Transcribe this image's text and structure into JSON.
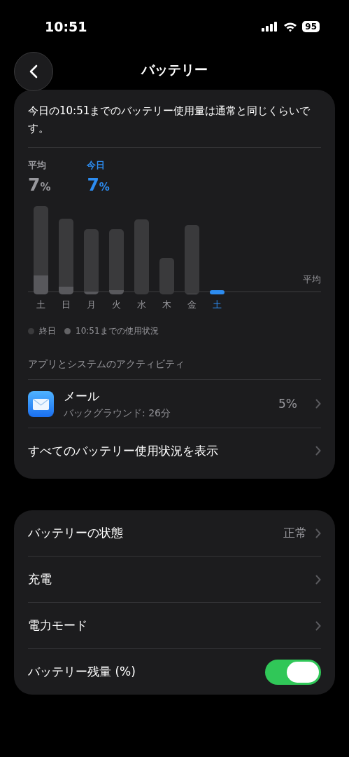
{
  "status_bar": {
    "time": "10:51",
    "battery": "95"
  },
  "nav": {
    "title": "バッテリー"
  },
  "summary": "今日の10:51までのバッテリー使用量は通常と同じくらいです。",
  "stats": [
    {
      "label": "平均",
      "value": "7",
      "unit": "%",
      "selected": false
    },
    {
      "label": "今日",
      "value": "7",
      "unit": "%",
      "selected": true
    }
  ],
  "chart": {
    "average_label": "平均",
    "days": [
      {
        "label": "土",
        "selected": false
      },
      {
        "label": "日",
        "selected": false
      },
      {
        "label": "月",
        "selected": false
      },
      {
        "label": "火",
        "selected": false
      },
      {
        "label": "水",
        "selected": false
      },
      {
        "label": "木",
        "selected": false
      },
      {
        "label": "金",
        "selected": false
      },
      {
        "label": "土",
        "selected": true
      }
    ],
    "legend": [
      {
        "label": "終日",
        "color": "#3a3a3c"
      },
      {
        "label": "10:51までの使用状況",
        "color": "#636366"
      }
    ]
  },
  "activity": {
    "header": "アプリとシステムのアクティビティ",
    "apps": [
      {
        "name": "メール",
        "detail": "バックグラウンド: 26分",
        "value": "5%"
      }
    ],
    "link": "すべてのバッテリー使用状況を表示"
  },
  "settings": [
    {
      "kind": "value",
      "label": "バッテリーの状態",
      "value": "正常"
    },
    {
      "kind": "link",
      "label": "充電"
    },
    {
      "kind": "link",
      "label": "電力モード"
    },
    {
      "kind": "toggle",
      "label": "バッテリー残量 (%)",
      "on": true
    }
  ]
}
